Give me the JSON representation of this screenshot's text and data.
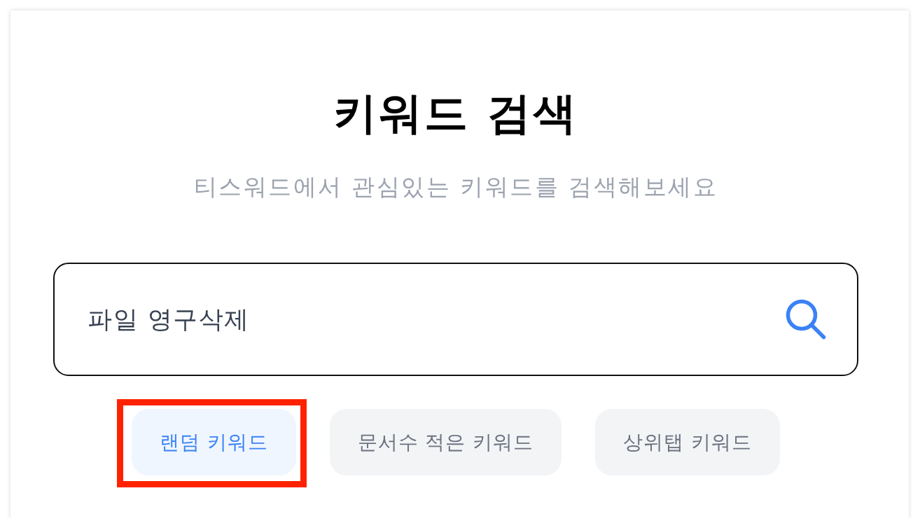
{
  "title": "키워드 검색",
  "subtitle": "티스워드에서 관심있는 키워드를 검색해보세요",
  "search": {
    "value": "파일 영구삭제"
  },
  "keyword_modes": [
    {
      "label": "랜덤 키워드",
      "selected": true,
      "highlighted": true
    },
    {
      "label": "문서수 적은 키워드",
      "selected": false,
      "highlighted": false
    },
    {
      "label": "상위탭 키워드",
      "selected": false,
      "highlighted": false
    }
  ]
}
